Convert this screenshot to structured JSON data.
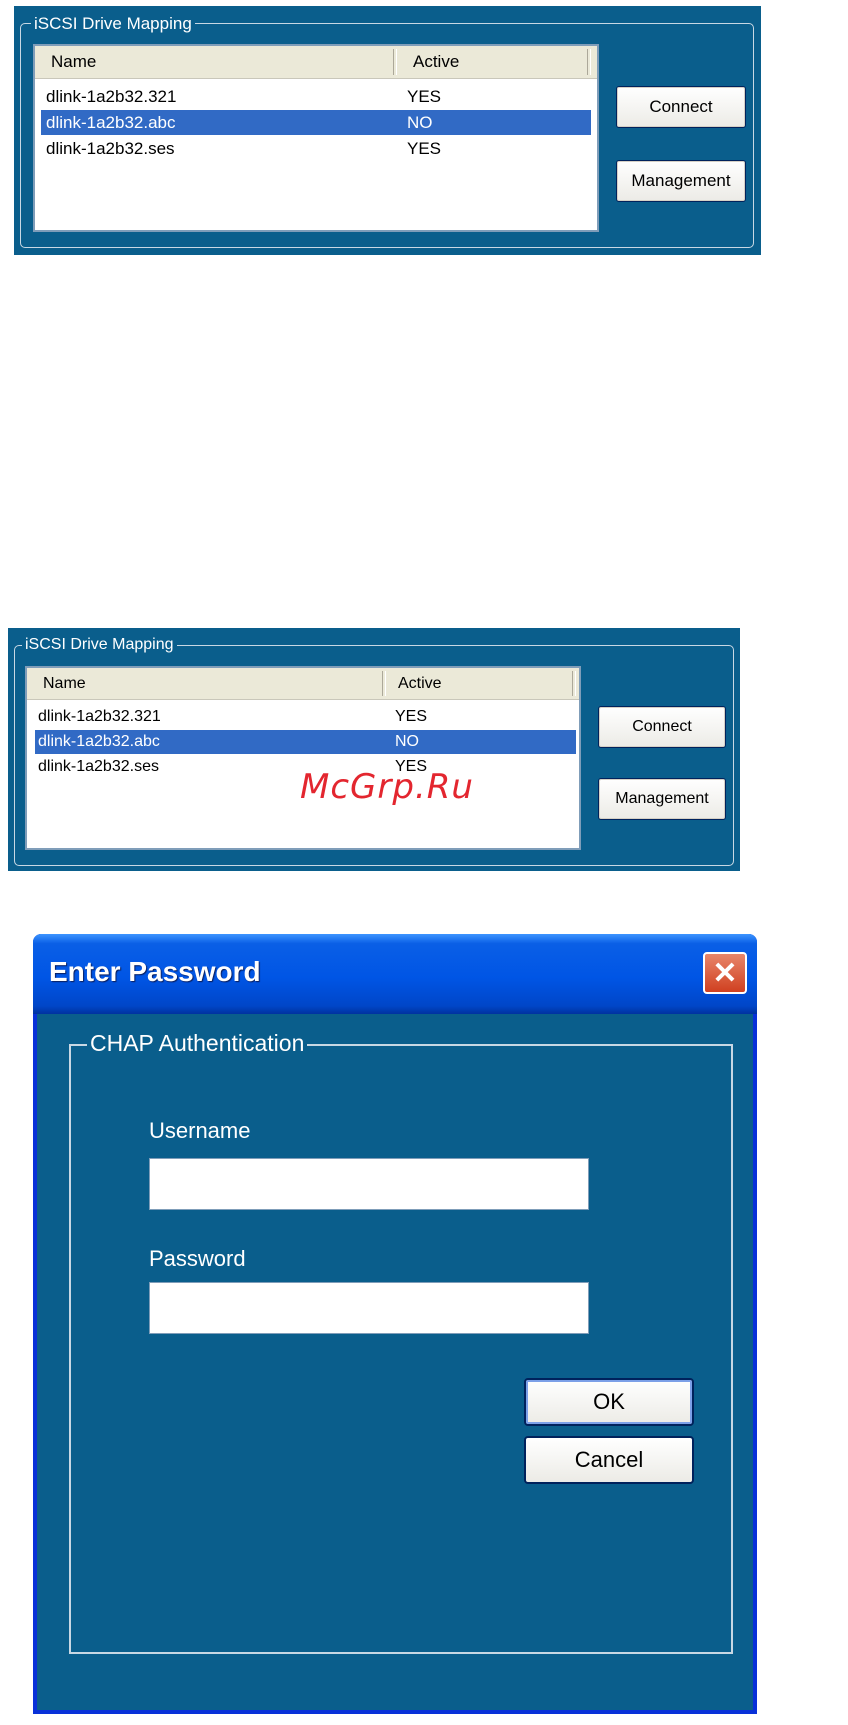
{
  "panel1": {
    "group_title": "iSCSI Drive Mapping",
    "columns": {
      "name": "Name",
      "active": "Active"
    },
    "rows": [
      {
        "name": "dlink-1a2b32.321",
        "active": "YES"
      },
      {
        "name": "dlink-1a2b32.abc",
        "active": "NO"
      },
      {
        "name": "dlink-1a2b32.ses",
        "active": "YES"
      }
    ],
    "selected_row": "dlink-1a2b32.abc",
    "connect_label": "Connect",
    "management_label": "Management"
  },
  "panel2": {
    "group_title": "iSCSI Drive Mapping",
    "columns": {
      "name": "Name",
      "active": "Active"
    },
    "rows": [
      {
        "name": "dlink-1a2b32.321",
        "active": "YES"
      },
      {
        "name": "dlink-1a2b32.abc",
        "active": "NO"
      },
      {
        "name": "dlink-1a2b32.ses",
        "active": "YES"
      }
    ],
    "selected_row": "dlink-1a2b32.abc",
    "connect_label": "Connect",
    "management_label": "Management"
  },
  "watermark": "McGrp.Ru",
  "dialog": {
    "title": "Enter Password",
    "close_icon": "close-icon",
    "group_title": "CHAP Authentication",
    "username_label": "Username",
    "username_value": "",
    "password_label": "Password",
    "password_value": "",
    "ok_label": "OK",
    "cancel_label": "Cancel"
  },
  "colors": {
    "panel_background": "#0a5e8c",
    "selection": "#316ac5",
    "titlebar": "#0055e5",
    "close_button": "#d04020",
    "watermark": "#e3262f"
  }
}
